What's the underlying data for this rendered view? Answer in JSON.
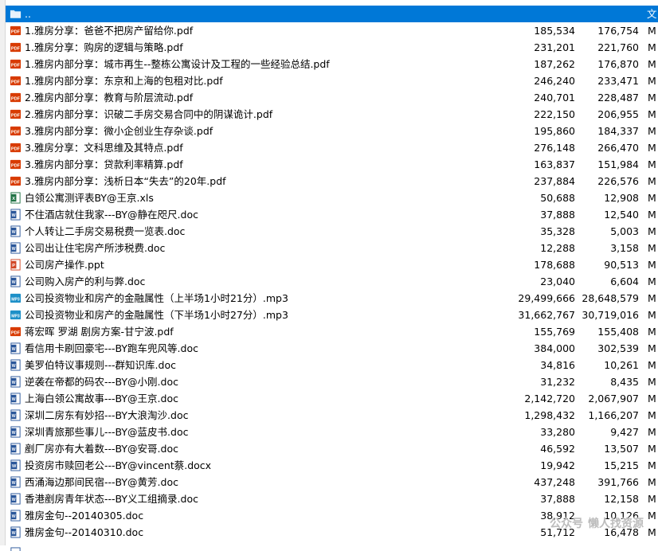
{
  "parent_row": {
    "name": "..",
    "kind": "文"
  },
  "files": [
    {
      "name": "1.雅房分享：爸爸不把房产留给你.pdf",
      "packed": "185,534",
      "size": "176,754",
      "kind": "M",
      "type": "pdf"
    },
    {
      "name": "1.雅房分享：购房的逻辑与策略.pdf",
      "packed": "231,201",
      "size": "221,760",
      "kind": "M",
      "type": "pdf"
    },
    {
      "name": "1.雅房内部分享：城市再生--整栋公寓设计及工程的一些经验总结.pdf",
      "packed": "187,262",
      "size": "176,870",
      "kind": "M",
      "type": "pdf"
    },
    {
      "name": "1.雅房内部分享：东京和上海的包租对比.pdf",
      "packed": "246,240",
      "size": "233,471",
      "kind": "M",
      "type": "pdf"
    },
    {
      "name": "2.雅房内部分享：教育与阶层流动.pdf",
      "packed": "240,701",
      "size": "228,487",
      "kind": "M",
      "type": "pdf"
    },
    {
      "name": "2.雅房内部分享：识破二手房交易合同中的阴谋诡计.pdf",
      "packed": "222,150",
      "size": "206,955",
      "kind": "M",
      "type": "pdf"
    },
    {
      "name": "3.雅房内部分享：微小企创业生存杂谈.pdf",
      "packed": "195,860",
      "size": "184,337",
      "kind": "M",
      "type": "pdf"
    },
    {
      "name": "3.雅房分享：文科思维及其特点.pdf",
      "packed": "276,148",
      "size": "266,470",
      "kind": "M",
      "type": "pdf"
    },
    {
      "name": "3.雅房内部分享：贷款利率精算.pdf",
      "packed": "163,837",
      "size": "151,984",
      "kind": "M",
      "type": "pdf"
    },
    {
      "name": "3.雅房内部分享：浅析日本“失去”的20年.pdf",
      "packed": "237,884",
      "size": "226,576",
      "kind": "M",
      "type": "pdf"
    },
    {
      "name": "白领公寓测评表BY@王京.xls",
      "packed": "50,688",
      "size": "12,908",
      "kind": "M",
      "type": "xls"
    },
    {
      "name": "不住酒店就住我家---BY@静在咫尺.doc",
      "packed": "37,888",
      "size": "12,540",
      "kind": "M",
      "type": "doc"
    },
    {
      "name": "个人转让二手房交易税费一览表.doc",
      "packed": "35,328",
      "size": "5,003",
      "kind": "M",
      "type": "doc"
    },
    {
      "name": "公司出让住宅房产所涉税费.doc",
      "packed": "12,288",
      "size": "3,158",
      "kind": "M",
      "type": "doc"
    },
    {
      "name": "公司房产操作.ppt",
      "packed": "178,688",
      "size": "90,513",
      "kind": "M",
      "type": "ppt"
    },
    {
      "name": "公司购入房产的利与弊.doc",
      "packed": "23,040",
      "size": "6,604",
      "kind": "M",
      "type": "doc"
    },
    {
      "name": "公司投资物业和房产的金融属性（上半场1小时21分）.mp3",
      "packed": "29,499,666",
      "size": "28,648,579",
      "kind": "M",
      "type": "mp3"
    },
    {
      "name": "公司投资物业和房产的金融属性（下半场1小时27分）.mp3",
      "packed": "31,662,767",
      "size": "30,719,016",
      "kind": "M",
      "type": "mp3"
    },
    {
      "name": "蒋宏晖 罗湖 剧房方案-甘宁波.pdf",
      "packed": "155,769",
      "size": "155,408",
      "kind": "M",
      "type": "pdf"
    },
    {
      "name": "看信用卡刷回豪宅---BY跑车兜风等.doc",
      "packed": "384,000",
      "size": "302,539",
      "kind": "M",
      "type": "doc"
    },
    {
      "name": "美罗伯特议事规则---群知识库.doc",
      "packed": "34,816",
      "size": "10,261",
      "kind": "M",
      "type": "doc"
    },
    {
      "name": "逆袭在帝都的码农---BY@小刚.doc",
      "packed": "31,232",
      "size": "8,435",
      "kind": "M",
      "type": "doc"
    },
    {
      "name": "上海白领公寓故事---BY@王京.doc",
      "packed": "2,142,720",
      "size": "2,067,907",
      "kind": "M",
      "type": "doc"
    },
    {
      "name": "深圳二房东有妙招---BY大浪淘沙.doc",
      "packed": "1,298,432",
      "size": "1,166,207",
      "kind": "M",
      "type": "doc"
    },
    {
      "name": "深圳青旅那些事儿---BY@蓝皮书.doc",
      "packed": "33,280",
      "size": "9,427",
      "kind": "M",
      "type": "doc"
    },
    {
      "name": "剷厂房亦有大着数---BY@安哥.doc",
      "packed": "46,592",
      "size": "13,507",
      "kind": "M",
      "type": "doc"
    },
    {
      "name": "投资房市赎回老公---BY@vincent蔡.docx",
      "packed": "19,942",
      "size": "15,215",
      "kind": "M",
      "type": "docx"
    },
    {
      "name": "西涌海边那间民宿---BY@黄芳.doc",
      "packed": "437,248",
      "size": "391,766",
      "kind": "M",
      "type": "doc"
    },
    {
      "name": "香港剷房青年状态---BY义工组摘录.doc",
      "packed": "37,888",
      "size": "12,158",
      "kind": "M",
      "type": "doc"
    },
    {
      "name": "雅房金句--20140305.doc",
      "packed": "38,912",
      "size": "10,126",
      "kind": "M",
      "type": "doc"
    },
    {
      "name": "雅房金句--20140310.doc",
      "packed": "51,712",
      "size": "16,478",
      "kind": "M",
      "type": "doc"
    }
  ],
  "watermark": {
    "account_label": "公众号",
    "name": "懒人找资源"
  },
  "colors": {
    "selection": "#0078d7",
    "pdf": "#d83b01",
    "xls": "#217346",
    "doc": "#2b579a",
    "ppt": "#d24726",
    "mp3": "#1e90c8"
  }
}
